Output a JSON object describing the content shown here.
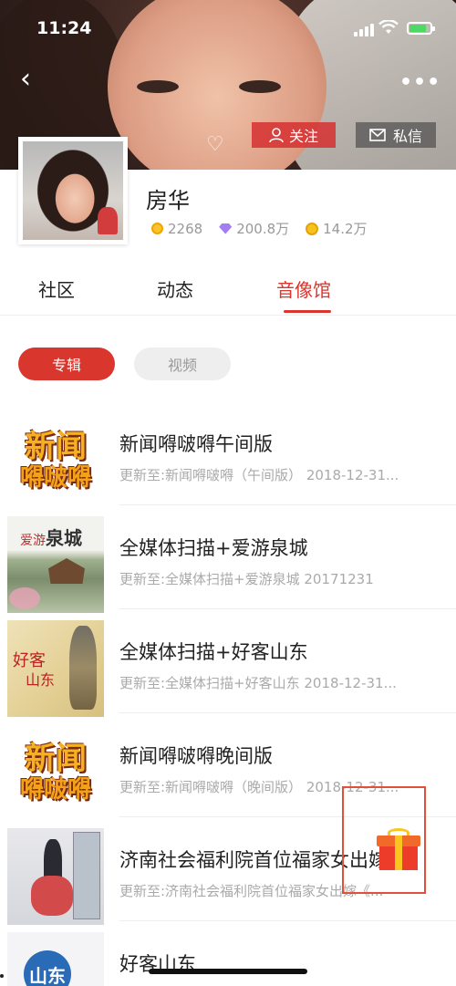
{
  "status": {
    "time": "11:24"
  },
  "header": {
    "follow_label": "关注",
    "message_label": "私信"
  },
  "profile": {
    "name": "房华",
    "stats": [
      {
        "icon": "gold-badge-icon",
        "value": "2268"
      },
      {
        "icon": "diamond-icon",
        "value": "200.8万"
      },
      {
        "icon": "coin-icon",
        "value": "14.2万"
      }
    ]
  },
  "tabs": [
    {
      "label": "社区",
      "active": false
    },
    {
      "label": "动态",
      "active": false
    },
    {
      "label": "音像馆",
      "active": true
    }
  ],
  "filters": [
    {
      "label": "专辑",
      "active": true
    },
    {
      "label": "视频",
      "active": false
    }
  ],
  "albums": [
    {
      "title": "新闻嘚啵嘚午间版",
      "subtitle": "更新至:新闻嘚啵嘚（午间版） 2018-12-31...",
      "thumb": "news",
      "thumb_text": [
        "新闻",
        "嘚啵嘚"
      ]
    },
    {
      "title": "全媒体扫描+爱游泉城",
      "subtitle": "更新至:全媒体扫描+爱游泉城 20171231",
      "thumb": "quancheng",
      "thumb_text": [
        "爱游",
        "泉城"
      ]
    },
    {
      "title": "全媒体扫描+好客山东",
      "subtitle": "更新至:全媒体扫描+好客山东 2018-12-31...",
      "thumb": "haoke",
      "thumb_text": [
        "好客",
        "山东"
      ]
    },
    {
      "title": "新闻嘚啵嘚晚间版",
      "subtitle": "更新至:新闻嘚啵嘚（晚间版） 2018-12-31...",
      "thumb": "news",
      "thumb_text": [
        "新闻",
        "嘚啵嘚"
      ]
    },
    {
      "title": "济南社会福利院首位福家女出嫁《..",
      "subtitle": "更新至:济南社会福利院首位福家女出嫁《...",
      "thumb": "welfare",
      "thumb_text": []
    },
    {
      "title": "好客山东",
      "subtitle": "",
      "thumb": "shandong",
      "thumb_text": [
        "山东"
      ]
    }
  ],
  "colors": {
    "accent": "#d9362e",
    "muted": "#aaaaaa"
  }
}
